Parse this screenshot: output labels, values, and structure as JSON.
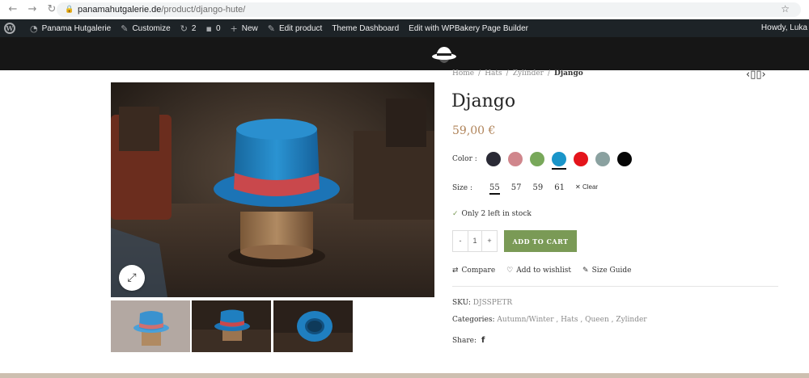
{
  "browser": {
    "url_host": "panamahutgalerie.de",
    "url_path": "/product/django-hute/"
  },
  "admin_bar": {
    "site_name": "Panama Hutgalerie",
    "customize": "Customize",
    "updates_count": "2",
    "comments_count": "0",
    "new": "New",
    "edit_product": "Edit product",
    "theme_dashboard": "Theme Dashboard",
    "wpbakery": "Edit with WPBakery Page Builder",
    "howdy": "Howdy, Luka"
  },
  "breadcrumb": {
    "items": [
      "Home",
      "Hats",
      "Zylinder"
    ],
    "current": "Django",
    "separator": "/"
  },
  "product": {
    "title": "Django",
    "price": "59,00 €",
    "color_label": "Color :",
    "colors": [
      "#2a2a35",
      "#d0868c",
      "#78a85a",
      "#1a95c9",
      "#e4141b",
      "#8aa1a0",
      "#060606"
    ],
    "selected_color_index": 3,
    "size_label": "Size :",
    "sizes": [
      "55",
      "57",
      "59",
      "61"
    ],
    "selected_size_index": 0,
    "clear_label": "Clear",
    "stock": "Only 2 left in stock",
    "qty_minus": "-",
    "qty_value": "1",
    "qty_plus": "+",
    "add_to_cart": "ADD TO CART",
    "compare": "Compare",
    "wishlist": "Add to wishlist",
    "size_guide": "Size Guide",
    "sku_label": "SKU:",
    "sku": "DJSSPETR",
    "categories_label": "Categories:",
    "categories": "Autumn/Winter , Hats , Queen , Zylinder",
    "share_label": "Share:"
  },
  "colors": {
    "accent": "#7a9a56",
    "price": "#b0845a",
    "hat_blue": "#1f7fc0",
    "hat_band": "#c9484c"
  }
}
